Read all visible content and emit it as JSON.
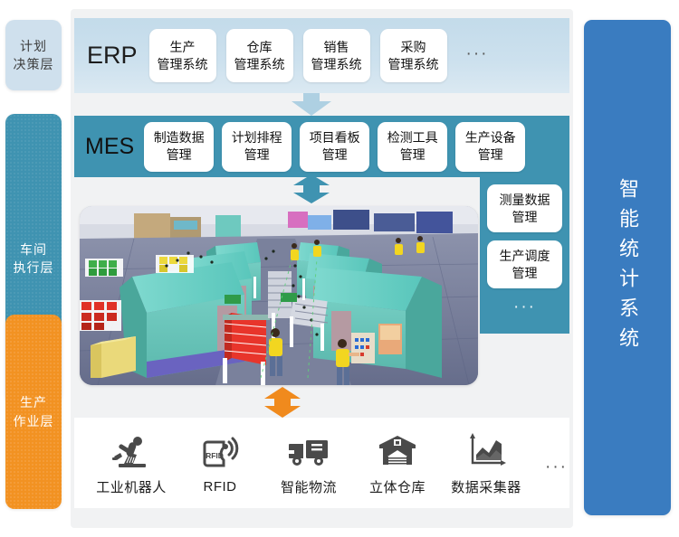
{
  "layers": [
    {
      "id": "plan",
      "line1": "计划",
      "line2": "决策层",
      "color": "#cfe0ed"
    },
    {
      "id": "shop",
      "line1": "车间",
      "line2": "执行层",
      "color": "#3f93b1"
    },
    {
      "id": "prod",
      "line1": "生产",
      "line2": "作业层",
      "color": "#f29222"
    }
  ],
  "erp": {
    "title": "ERP",
    "band_color": "#c8dfec",
    "more": "···",
    "chips": [
      {
        "l1": "生产",
        "l2": "管理系统"
      },
      {
        "l1": "仓库",
        "l2": "管理系统"
      },
      {
        "l1": "销售",
        "l2": "管理系统"
      },
      {
        "l1": "采购",
        "l2": "管理系统"
      }
    ]
  },
  "mes": {
    "title": "MES",
    "band_color": "#3f93b1",
    "more": "···",
    "chips": [
      {
        "l1": "制造数据",
        "l2": "管理"
      },
      {
        "l1": "计划排程",
        "l2": "管理"
      },
      {
        "l1": "项目看板",
        "l2": "管理"
      },
      {
        "l1": "检测工具",
        "l2": "管理"
      },
      {
        "l1": "生产设备",
        "l2": "管理"
      }
    ],
    "side_chips": [
      {
        "l1": "测量数据",
        "l2": "管理"
      },
      {
        "l1": "生产调度",
        "l2": "管理"
      }
    ]
  },
  "arrows": {
    "erp_to_mes": {
      "direction": "down",
      "color": "#a9cfe2"
    },
    "mes_to_scene": {
      "direction": "up-down",
      "color": "#3f93b1"
    },
    "scene_to_devices": {
      "direction": "up-down",
      "color": "#f08a1d"
    }
  },
  "scene": {
    "alt": "三维车间产线示意图"
  },
  "devices": {
    "more": "···",
    "items": [
      {
        "icon": "robot-arm-icon",
        "label": "工业机器人"
      },
      {
        "icon": "rfid-icon",
        "label": "RFID"
      },
      {
        "icon": "truck-icon",
        "label": "智能物流"
      },
      {
        "icon": "warehouse-icon",
        "label": "立体仓库"
      },
      {
        "icon": "data-chart-icon",
        "label": "数据采集器"
      }
    ]
  },
  "right_panel": {
    "title": "智能统计系统",
    "color": "#3a7cc0"
  }
}
